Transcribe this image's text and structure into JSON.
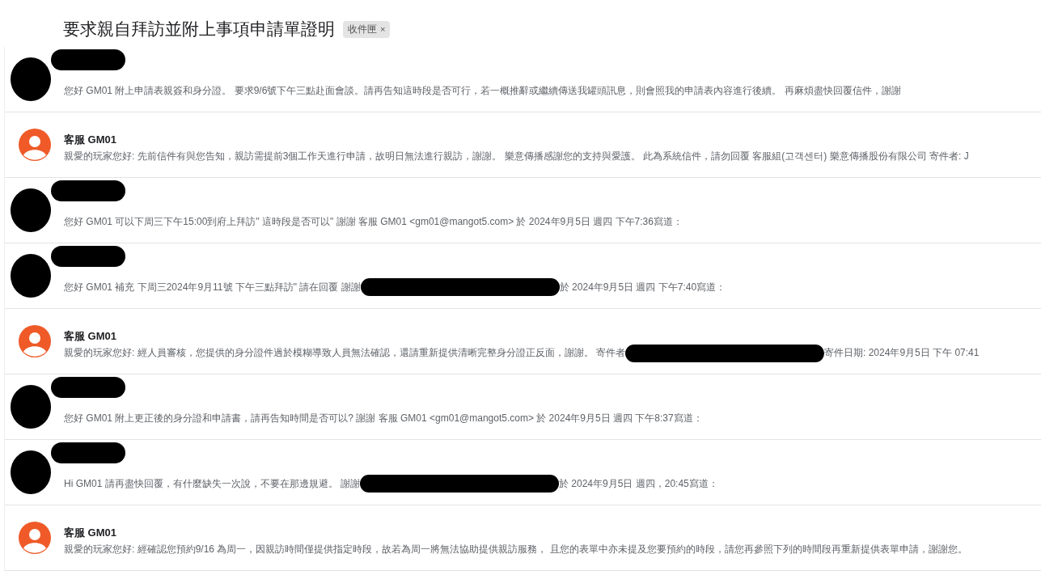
{
  "thread": {
    "subject": "要求親自拜訪並附上事項申請單證明",
    "label": {
      "text": "收件匣",
      "close": "×"
    }
  },
  "messages": [
    {
      "kind": "redacted",
      "snippet": [
        {
          "kind": "text",
          "text": "您好 GM01 附上申請表親簽和身分證。 要求9/6號下午三點赴面會談。請再告知這時段是否可行，若一概推辭或繼續傳送我罐頭訊息，則會照我的申請表內容進行後續。 再麻煩盡快回覆信件，謝謝"
        }
      ]
    },
    {
      "kind": "sender",
      "name": "客服 GM01",
      "snippet": [
        {
          "kind": "text",
          "text": "親愛的玩家您好: 先前信件有與您告知，親訪需提前3個工作天進行申請，故明日無法進行親訪，謝謝。 樂意傳播感謝您的支持與愛護。 此為系統信件，請勿回覆 客服組(고객센터) 樂意傳播股份有限公司 寄件者: J"
        }
      ]
    },
    {
      "kind": "redacted",
      "snippet": [
        {
          "kind": "text",
          "text": "您好 GM01 可以下周三下午15:00到府上拜訪\" 這時段是否可以\" 謝謝 客服 GM01 <gm01@mangot5.com> 於 2024年9月5日 週四 下午7:36寫道："
        }
      ]
    },
    {
      "kind": "redacted",
      "snippet": [
        {
          "kind": "text",
          "text": "您好 GM01 補充 下周三2024年9月11號 下午三點拜訪\" 請在回覆 謝謝"
        },
        {
          "kind": "redaction"
        },
        {
          "kind": "text",
          "text": "於 2024年9月5日 週四 下午7:40寫道："
        }
      ]
    },
    {
      "kind": "sender",
      "name": "客服 GM01",
      "snippet": [
        {
          "kind": "text",
          "text": "親愛的玩家您好: 經人員審核，您提供的身分證件過於模糊導致人員無法確認，還請重新提供清晰完整身分證正反面，謝謝。 寄件者"
        },
        {
          "kind": "redaction"
        },
        {
          "kind": "text",
          "text": "寄件日期: 2024年9月5日 下午 07:41"
        }
      ]
    },
    {
      "kind": "redacted",
      "snippet": [
        {
          "kind": "text",
          "text": "您好 GM01 附上更正後的身分證和申請書，請再告知時間是否可以? 謝謝 客服 GM01 <gm01@mangot5.com> 於 2024年9月5日 週四 下午8:37寫道："
        }
      ]
    },
    {
      "kind": "redacted",
      "snippet": [
        {
          "kind": "text",
          "text": "Hi GM01 請再盡快回覆，有什麼缺失一次說，不要在那邊規避。 謝謝"
        },
        {
          "kind": "redaction"
        },
        {
          "kind": "text",
          "text": "於 2024年9月5日 週四，20:45寫道："
        }
      ]
    },
    {
      "kind": "sender",
      "name": "客服 GM01",
      "snippet": [
        {
          "kind": "text",
          "text": "親愛的玩家您好: 經確認您預約9/16 為周一，因親訪時間僅提供指定時段，故若為周一將無法協助提供親訪服務， 且您的表單中亦未提及您要預約的時段，請您再參照下列的時間段再重新提供表單申請，謝謝您。"
        }
      ]
    }
  ]
}
